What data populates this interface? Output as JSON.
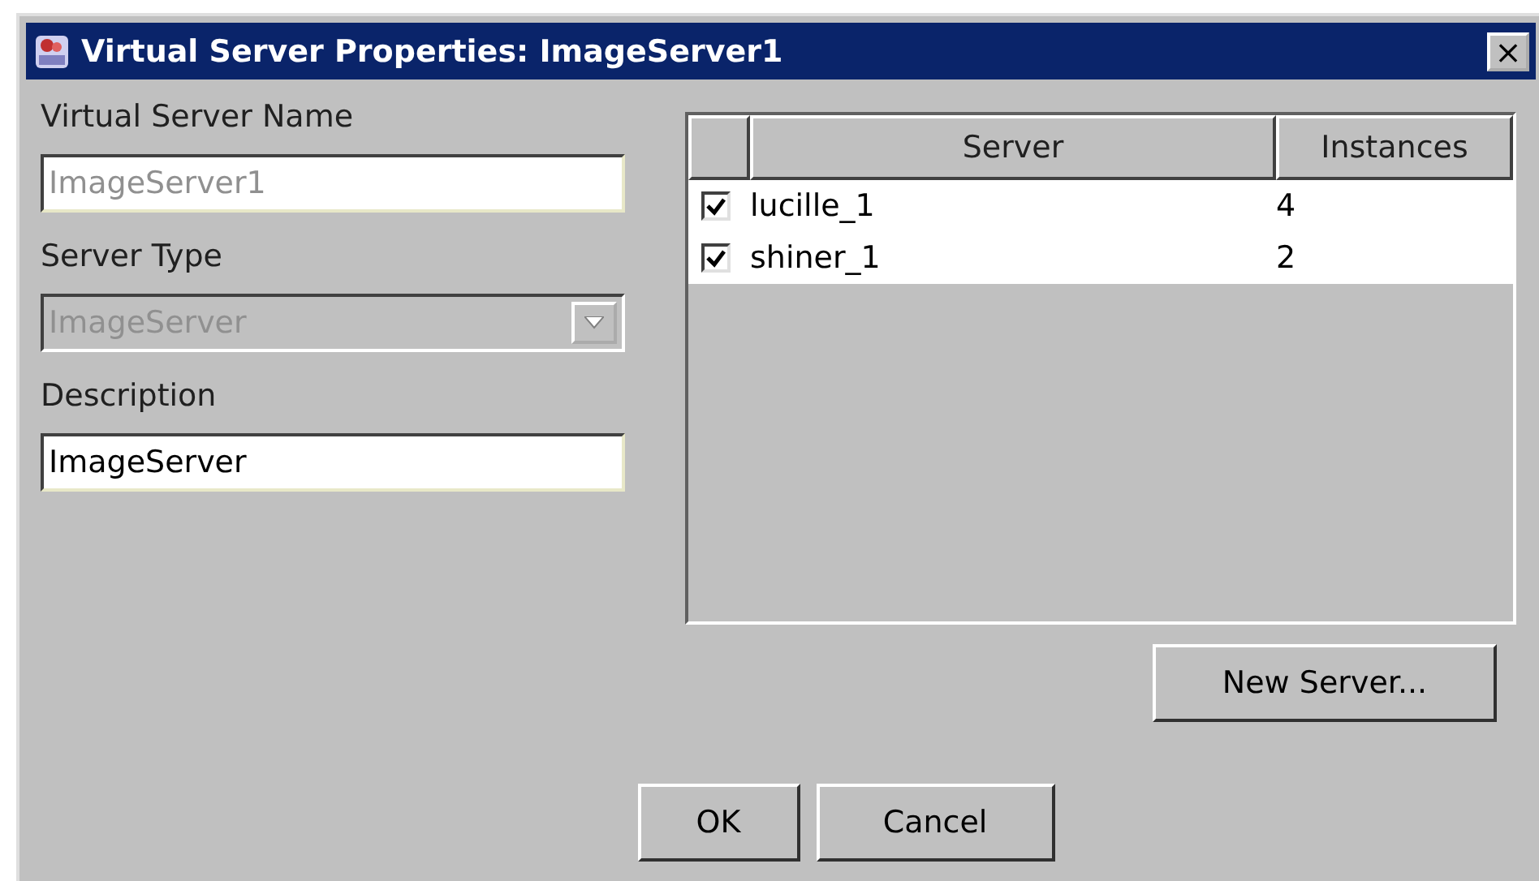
{
  "window": {
    "title": "Virtual Server Properties: ImageServer1",
    "close": "×"
  },
  "fields": [
    {
      "kind": "text",
      "label": "Virtual Server Name",
      "value": "ImageServer1",
      "disabled": true
    },
    {
      "kind": "combo",
      "label": "Server Type",
      "value": "ImageServer",
      "disabled": true
    },
    {
      "kind": "text",
      "label": "Description",
      "value": "ImageServer",
      "disabled": false
    }
  ],
  "table": {
    "columns": [
      "Server",
      "Instances"
    ],
    "rows": [
      {
        "checked": true,
        "server": "lucille_1",
        "instances": "4"
      },
      {
        "checked": true,
        "server": "shiner_1",
        "instances": "2"
      }
    ]
  },
  "new_server_button": "New Server...",
  "buttons": [
    "OK",
    "Cancel"
  ]
}
